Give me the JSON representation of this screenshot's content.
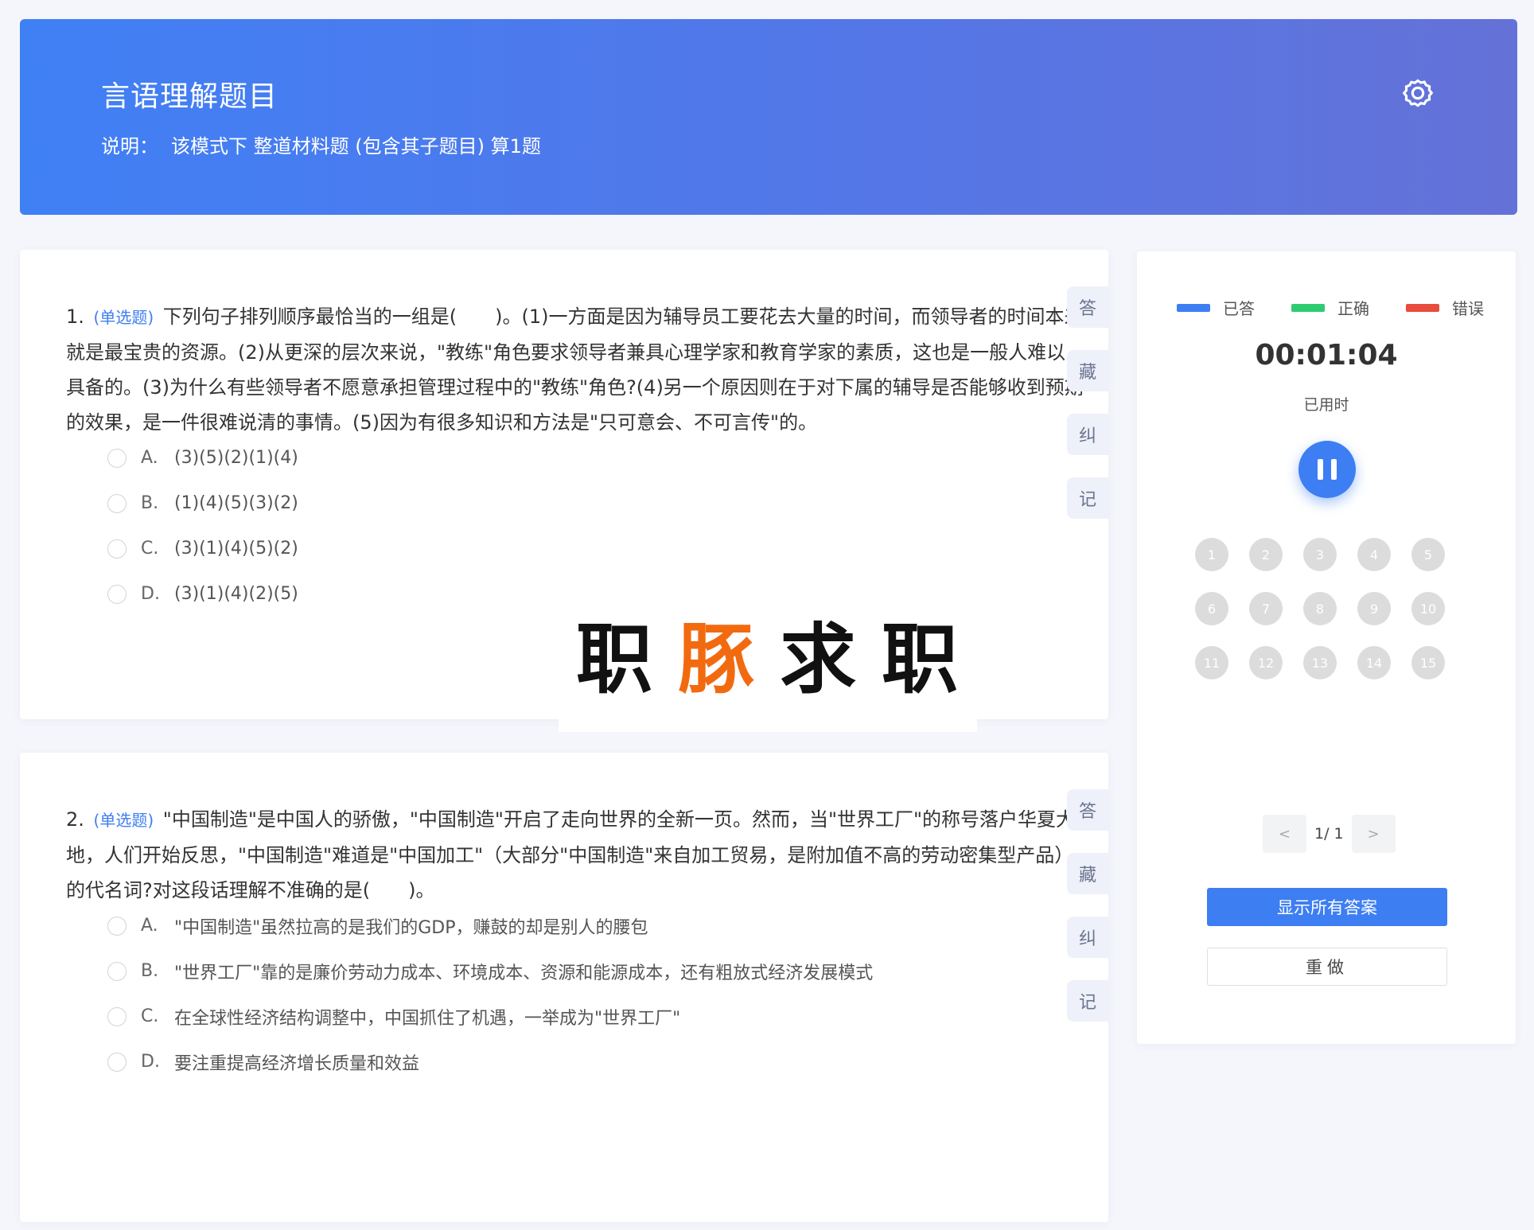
{
  "header": {
    "title": "言语理解题目",
    "desc_label": "说明：",
    "desc_text": "该模式下 整道材料题 (包含其子题目) 算1题",
    "settings_icon": "gear-icon"
  },
  "questions": [
    {
      "number": "1.",
      "type": "(单选题)",
      "stem": "下列句子排列顺序最恰当的一组是(　　)。(1)一方面是因为辅导员工要花去大量的时间，而领导者的时间本来就是最宝贵的资源。(2)从更深的层次来说，\"教练\"角色要求领导者兼具心理学家和教育学家的素质，这也是一般人难以具备的。(3)为什么有些领导者不愿意承担管理过程中的\"教练\"角色?(4)另一个原因则在于对下属的辅导是否能够收到预期的效果，是一件很难说清的事情。(5)因为有很多知识和方法是\"只可意会、不可言传\"的。",
      "options": [
        {
          "letter": "A.",
          "text": "(3)(5)(2)(1)(4)"
        },
        {
          "letter": "B.",
          "text": "(1)(4)(5)(3)(2)"
        },
        {
          "letter": "C.",
          "text": "(3)(1)(4)(5)(2)"
        },
        {
          "letter": "D.",
          "text": "(3)(1)(4)(2)(5)"
        }
      ],
      "tools": [
        "答",
        "藏",
        "纠",
        "记"
      ]
    },
    {
      "number": "2.",
      "type": "(单选题)",
      "stem": "\"中国制造\"是中国人的骄傲，\"中国制造\"开启了走向世界的全新一页。然而，当\"世界工厂\"的称号落户华夏大地，人们开始反思，\"中国制造\"难道是\"中国加工\"（大部分\"中国制造\"来自加工贸易，是附加值不高的劳动密集型产品）的代名词?对这段话理解不准确的是(　　)。",
      "options": [
        {
          "letter": "A.",
          "text": "\"中国制造\"虽然拉高的是我们的GDP，赚鼓的却是别人的腰包"
        },
        {
          "letter": "B.",
          "text": "\"世界工厂\"靠的是廉价劳动力成本、环境成本、资源和能源成本，还有粗放式经济发展模式"
        },
        {
          "letter": "C.",
          "text": "在全球性经济结构调整中，中国抓住了机遇，一举成为\"世界工厂\""
        },
        {
          "letter": "D.",
          "text": "要注重提高经济增长质量和效益"
        }
      ],
      "tools": [
        "答",
        "藏",
        "纠",
        "记"
      ]
    }
  ],
  "watermark": {
    "c1": "职",
    "c2": "豚",
    "c3": "求",
    "c4": "职"
  },
  "panel": {
    "legend": [
      {
        "label": "已答",
        "color": "#3d7ef2"
      },
      {
        "label": "正确",
        "color": "#2ecc71"
      },
      {
        "label": "错误",
        "color": "#e74c3c"
      }
    ],
    "timer": "00:01:04",
    "timer_label": "已用时",
    "numbers": [
      "1",
      "2",
      "3",
      "4",
      "5",
      "6",
      "7",
      "8",
      "9",
      "10",
      "11",
      "12",
      "13",
      "14",
      "15"
    ],
    "pager": {
      "prev": "<",
      "info": "1/ 1",
      "next": ">"
    },
    "show_answers": "显示所有答案",
    "redo": "重做"
  }
}
